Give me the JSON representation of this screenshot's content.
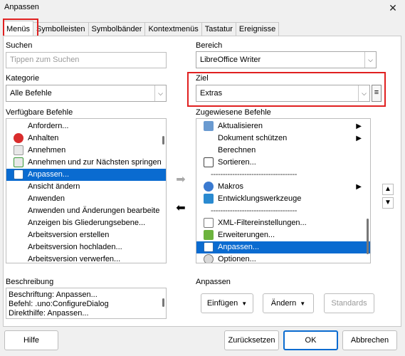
{
  "window": {
    "title": "Anpassen",
    "close_glyph": "✕"
  },
  "tabs": [
    {
      "label": "Menüs",
      "active": true
    },
    {
      "label": "Symbolleisten"
    },
    {
      "label": "Symbolbänder"
    },
    {
      "label": "Kontextmenüs"
    },
    {
      "label": "Tastatur"
    },
    {
      "label": "Ereignisse"
    }
  ],
  "left": {
    "search_label": "Suchen",
    "search_placeholder": "Tippen zum Suchen",
    "category_label": "Kategorie",
    "category_value": "Alle Befehle",
    "available_label": "Verfügbare Befehle",
    "available": [
      {
        "label": "Anfordern...",
        "icon": ""
      },
      {
        "label": "Anhalten",
        "icon": "stop-icon"
      },
      {
        "label": "Annehmen",
        "icon": "accept-icon"
      },
      {
        "label": "Annehmen und zur Nächsten springen",
        "icon": "accept-next-icon"
      },
      {
        "label": "Anpassen...",
        "icon": "customize-icon",
        "selected": true
      },
      {
        "label": "Ansicht ändern",
        "icon": ""
      },
      {
        "label": "Anwenden",
        "icon": ""
      },
      {
        "label": "Anwenden und Änderungen bearbeite",
        "icon": ""
      },
      {
        "label": "Anzeigen bis Gliederungsebene...",
        "icon": ""
      },
      {
        "label": "Arbeitsversion erstellen",
        "icon": ""
      },
      {
        "label": "Arbeitsversion hochladen...",
        "icon": ""
      },
      {
        "label": "Arbeitsversion verwerfen...",
        "icon": ""
      }
    ],
    "description_label": "Beschreibung",
    "description_lines": [
      "Beschriftung: Anpassen...",
      "Befehl: .uno:ConfigureDialog",
      "Direkthilfe: Anpassen..."
    ]
  },
  "right": {
    "scope_label": "Bereich",
    "scope_value": "LibreOffice Writer",
    "target_label": "Ziel",
    "target_value": "Extras",
    "menu_glyph": "≡",
    "assigned_label": "Zugewiesene Befehle",
    "assigned": [
      {
        "label": "Aktualisieren",
        "icon": "",
        "submenu": true
      },
      {
        "label": "Dokument schützen",
        "icon": "",
        "submenu": true
      },
      {
        "label": "Berechnen",
        "icon": ""
      },
      {
        "label": "Sortieren...",
        "icon": "sort-icon"
      },
      {
        "label": "------------------------------------",
        "separator": true
      },
      {
        "label": "Makros",
        "icon": "macros-icon",
        "submenu": true
      },
      {
        "label": "Entwicklungswerkzeuge",
        "icon": "devtools-icon"
      },
      {
        "label": "------------------------------------",
        "separator": true
      },
      {
        "label": "XML-Filtereinstellungen...",
        "icon": "xml-filter-icon"
      },
      {
        "label": "Erweiterungen...",
        "icon": "extensions-icon"
      },
      {
        "label": "Anpassen...",
        "icon": "customize-icon",
        "selected": true
      },
      {
        "label": "Optionen...",
        "icon": "options-icon"
      }
    ],
    "customize_label": "Anpassen",
    "insert_button": "Einfügen",
    "modify_button": "Ändern",
    "standards_button": "Standards"
  },
  "center": {
    "add_arrow": "➡",
    "remove_arrow": "⬅"
  },
  "updown": {
    "up": "▲",
    "down": "▼"
  },
  "footer": {
    "help": "Hilfe",
    "reset": "Zurücksetzen",
    "ok": "OK",
    "cancel": "Abbrechen"
  },
  "colors": {
    "accent": "#0a6bd0",
    "highlight_box": "#e02020"
  }
}
